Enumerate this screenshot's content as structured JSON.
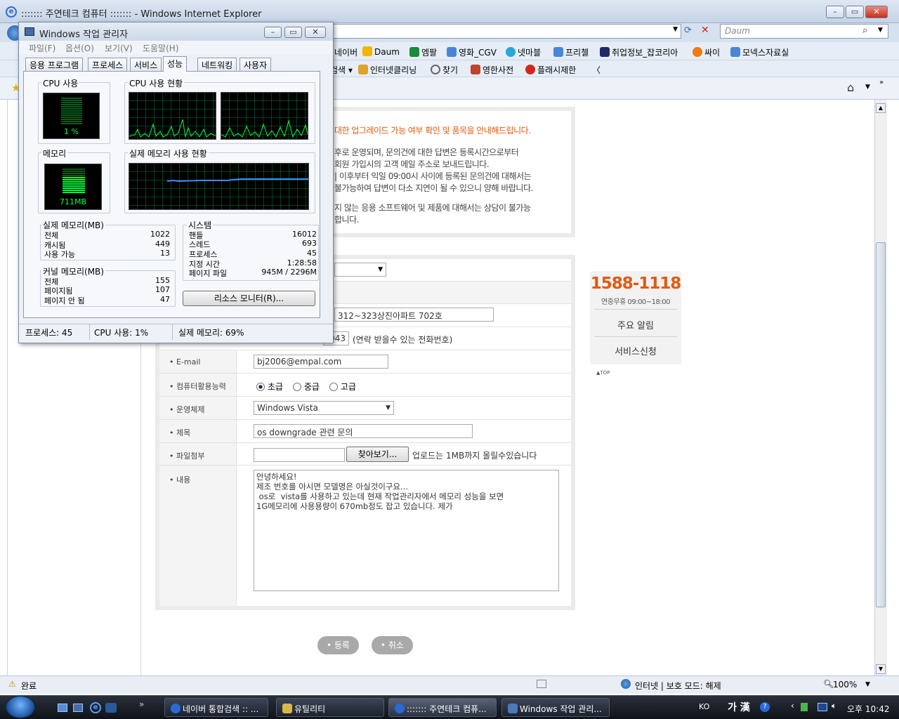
{
  "ie": {
    "title": "::::::: 주연테크 컴퓨터 ::::::: - Windows Internet Explorer",
    "search_placeholder": "Daum",
    "favorites": [
      "네이버",
      "Daum",
      "엠팔",
      "영화_CGV",
      "넷마블",
      "프리첼",
      "취업정보_잡코리아",
      "싸이",
      "모넥스자료실"
    ],
    "links": [
      "검색 ▾",
      "인터넷클리닝",
      "찾기",
      "영한사전",
      "플래시제한",
      "〈"
    ],
    "status_left": "완료",
    "status_zone": "인터넷 | 보호 모드: 해제",
    "zoom": "100%"
  },
  "notice": {
    "headline": "대한 업그레이드 가능 여부 확인 및 품목을 안내해드립니다.",
    "lines": [
      "후로 운영되며, 문의건에 대한 답변은 등록시간으로부터",
      "회원 가입시의 고객 메일 주소로 보내드립니다.",
      "| 이후부터 익일 09:00시 사이에 등록된 문의건에 대해서는",
      "불가능하여 답변이 다소 지연이 될 수 있으니 양해 바랍니다.",
      "지 않는 응용 소프트웨어 및 제품에 대해서는 상담이 불가능",
      "합니다."
    ]
  },
  "form": {
    "address_value": "312~323상진아파트 702호",
    "phone_value": "943",
    "phone_hint": "(연락 받을수 있는 전화번호)",
    "email_label": "• E-mail",
    "email_value": "bj2006@empal.com",
    "skill_label": "• 컴퓨터활용능력",
    "skill_options": [
      "초급",
      "중급",
      "고급"
    ],
    "os_label": "• 운영체제",
    "os_value": "Windows Vista",
    "subject_label": "• 제목",
    "subject_value": "os  downgrade 관련 문의",
    "file_label": "• 파일첨부",
    "browse_label": "찾아보기...",
    "file_hint": "업로드는 1MB까지 올릴수있습니다",
    "content_label": "• 내용",
    "content_value": "안녕하세요!\n제조 번호를 아시면 모델명은 아실것이구요...\n os로  vista를 사용하고 있는데 현재 작업관리자에서 메모리 성능을 보면\n1G메모리에 사용용량이 670mb정도 잡고 있습니다. 제가",
    "submit_label": "• 등록",
    "cancel_label": "• 취소"
  },
  "sidebar": {
    "phone": "1588-1118",
    "hours": "연중무휴 09:00~18:00",
    "notice_link": "주요 알림",
    "service_link": "서비스신청",
    "top_link": "▲TOP"
  },
  "taskmgr": {
    "title": "Windows 작업 관리자",
    "menu": [
      "파일(F)",
      "옵션(O)",
      "보기(V)",
      "도움말(H)"
    ],
    "tabs": [
      "응용 프로그램",
      "프로세스",
      "서비스",
      "성능",
      "네트워킹",
      "사용자"
    ],
    "active_tab": "성능",
    "cpu_usage_title": "CPU 사용",
    "cpu_usage_value": "1 %",
    "cpu_history_title": "CPU 사용 현황",
    "memory_title": "메모리",
    "memory_value": "711MB",
    "mem_history_title": "실제 메모리 사용 현황",
    "physical": {
      "title": "실제 메모리(MB)",
      "rows": [
        [
          "전체",
          "1022"
        ],
        [
          "캐시됨",
          "449"
        ],
        [
          "사용 가능",
          "13"
        ]
      ]
    },
    "kernel": {
      "title": "커널 메모리(MB)",
      "rows": [
        [
          "전체",
          "155"
        ],
        [
          "페이지됨",
          "107"
        ],
        [
          "페이지 안 됨",
          "47"
        ]
      ]
    },
    "system": {
      "title": "시스템",
      "rows": [
        [
          "핸들",
          "16012"
        ],
        [
          "스레드",
          "693"
        ],
        [
          "프로세스",
          "45"
        ],
        [
          "지정 시간",
          "1:28:58"
        ],
        [
          "페이지 파일",
          "945M / 2296M"
        ]
      ]
    },
    "resource_button": "리소스 모니터(R)...",
    "status": [
      "프로세스: 45",
      "CPU 사용: 1%",
      "실제 메모리: 69%"
    ]
  },
  "taskbar": {
    "buttons": [
      "네이버 통합검색 :: ...",
      "유틸리티",
      "::::::: 주연테크 컴퓨...",
      "Windows 작업 관리..."
    ],
    "lang": "KO",
    "ime": "가 漢",
    "clock": "오후 10:42"
  },
  "colors": {
    "accent_orange": "#e05a12",
    "graph_green": "#00ff3c",
    "grid_green": "#008040",
    "mem_line": "#3c8cff"
  }
}
